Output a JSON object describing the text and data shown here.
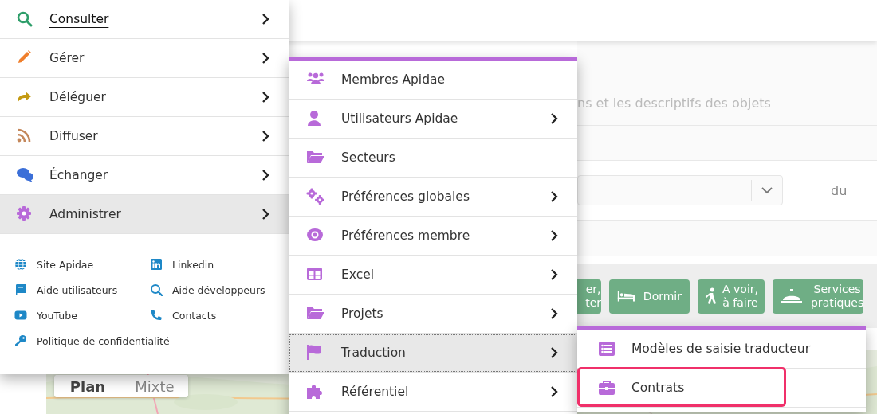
{
  "search": {
    "placeholder": "ns et les descriptifs des objets"
  },
  "date_label": "du",
  "category_buttons": [
    {
      "label": "er,\nter"
    },
    {
      "label": "Dormir"
    },
    {
      "label": "A voir,\nà faire"
    },
    {
      "label": "Services\npratiques"
    }
  ],
  "map": {
    "view_buttons": [
      {
        "label": "Plan",
        "selected": true
      },
      {
        "label": "Mixte",
        "selected": false
      }
    ]
  },
  "main_menu": {
    "items": [
      {
        "label": "Consulter",
        "selected": false,
        "focused": true,
        "has_submenu": true
      },
      {
        "label": "Gérer",
        "selected": false,
        "focused": false,
        "has_submenu": true
      },
      {
        "label": "Déléguer",
        "selected": false,
        "focused": false,
        "has_submenu": true
      },
      {
        "label": "Diffuser",
        "selected": false,
        "focused": false,
        "has_submenu": true
      },
      {
        "label": "Échanger",
        "selected": false,
        "focused": false,
        "has_submenu": true
      },
      {
        "label": "Administrer",
        "selected": true,
        "focused": false,
        "has_submenu": true
      }
    ],
    "links": [
      {
        "label": "Site Apidae"
      },
      {
        "label": "Linkedin"
      },
      {
        "label": "Aide utilisateurs"
      },
      {
        "label": "Aide développeurs"
      },
      {
        "label": "YouTube"
      },
      {
        "label": "Contacts"
      },
      {
        "label": "Politique de confidentialité"
      }
    ]
  },
  "submenu": {
    "items": [
      {
        "label": "Membres Apidae",
        "selected": false,
        "has_submenu": false
      },
      {
        "label": "Utilisateurs Apidae",
        "selected": false,
        "has_submenu": true
      },
      {
        "label": "Secteurs",
        "selected": false,
        "has_submenu": false
      },
      {
        "label": "Préférences globales",
        "selected": false,
        "has_submenu": true
      },
      {
        "label": "Préférences membre",
        "selected": false,
        "has_submenu": true
      },
      {
        "label": "Excel",
        "selected": false,
        "has_submenu": true
      },
      {
        "label": "Projets",
        "selected": false,
        "has_submenu": true
      },
      {
        "label": "Traduction",
        "selected": true,
        "has_submenu": true
      },
      {
        "label": "Référentiel",
        "selected": false,
        "has_submenu": true
      }
    ]
  },
  "subsubmenu": {
    "items": [
      {
        "label": "Modèles de saisie traducteur",
        "highlighted": false
      },
      {
        "label": "Contrats",
        "highlighted": true
      }
    ]
  }
}
